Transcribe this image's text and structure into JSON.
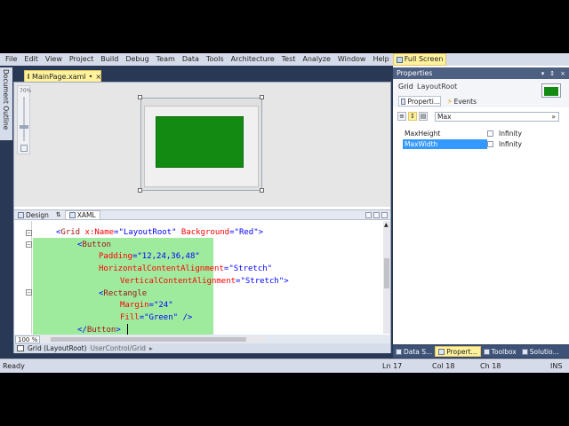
{
  "menu": {
    "items": [
      "File",
      "Edit",
      "View",
      "Project",
      "Build",
      "Debug",
      "Team",
      "Data",
      "Tools",
      "Architecture",
      "Test",
      "Analyze",
      "Window",
      "Help"
    ],
    "full_screen": "Full Screen"
  },
  "side_tab": {
    "label": "Document Outline"
  },
  "document": {
    "tab_title": "MainPage.xaml",
    "tab_modified": "•",
    "close": "×"
  },
  "designer": {
    "zoom_rail_label": "70%",
    "rectangle_fill": "#138b13"
  },
  "split": {
    "design_tab": "Design",
    "swap": "⇅",
    "xaml_tab": "XAML"
  },
  "code": {
    "lines": [
      {
        "indent": 0,
        "parts": [
          [
            "bracket",
            "<"
          ],
          [
            "tag",
            "Grid"
          ],
          [
            "attr",
            " x:Name"
          ],
          [
            "bracket",
            "="
          ],
          [
            "val",
            "\"LayoutRoot\""
          ],
          [
            "attr",
            " Background"
          ],
          [
            "bracket",
            "="
          ],
          [
            "val",
            "\"Red\""
          ],
          [
            "bracket",
            ">"
          ]
        ]
      },
      {
        "indent": 1,
        "parts": [
          [
            "bracket",
            "<"
          ],
          [
            "tag",
            "Button"
          ]
        ]
      },
      {
        "indent": 2,
        "parts": [
          [
            "attr",
            "Padding"
          ],
          [
            "bracket",
            "="
          ],
          [
            "val",
            "\"12,24,36,48\""
          ]
        ]
      },
      {
        "indent": 2,
        "parts": [
          [
            "attr",
            "HorizontalContentAlignment"
          ],
          [
            "bracket",
            "="
          ],
          [
            "val",
            "\"Stretch\""
          ]
        ]
      },
      {
        "indent": 3,
        "parts": [
          [
            "attr",
            "VerticalContentAlignment"
          ],
          [
            "bracket",
            "="
          ],
          [
            "val",
            "\"Stretch\""
          ],
          [
            "bracket",
            ">"
          ]
        ]
      },
      {
        "indent": 2,
        "parts": [
          [
            "bracket",
            "<"
          ],
          [
            "tag",
            "Rectangle"
          ]
        ]
      },
      {
        "indent": 3,
        "parts": [
          [
            "attr",
            "Margin"
          ],
          [
            "bracket",
            "="
          ],
          [
            "val",
            "\"24\""
          ]
        ]
      },
      {
        "indent": 3,
        "parts": [
          [
            "attr",
            "Fill"
          ],
          [
            "bracket",
            "="
          ],
          [
            "val",
            "\"Green\""
          ],
          [
            "bracket",
            " />"
          ]
        ]
      },
      {
        "indent": 1,
        "parts": [
          [
            "bracket",
            "</"
          ],
          [
            "tag",
            "Button"
          ],
          [
            "bracket",
            ">"
          ]
        ]
      }
    ]
  },
  "editor_footer": {
    "zoom": "100 %"
  },
  "breadcrumb": {
    "current": "Grid (LayoutRoot)",
    "path": "UserControl/Grid",
    "arrow": "▸"
  },
  "properties": {
    "title": "Properties",
    "title_controls": [
      "▾",
      "↕",
      "×"
    ],
    "element_type": "Grid",
    "element_name": "LayoutRoot",
    "swatch_color": "#138b13",
    "tab_properties": "Properti...",
    "tab_events": "Events",
    "search_value": "Max",
    "search_clear": "»",
    "rows": [
      {
        "name": "MaxHeight",
        "value": "Infinity"
      },
      {
        "name": "MaxWidth",
        "value": "Infinity"
      }
    ],
    "bottom_tabs": [
      "Data S...",
      "Propert...",
      "Toolbox",
      "Solutio..."
    ]
  },
  "status": {
    "state": "Ready",
    "line": "Ln 17",
    "col": "Col 18",
    "ch": "Ch 18",
    "mode": "INS"
  }
}
